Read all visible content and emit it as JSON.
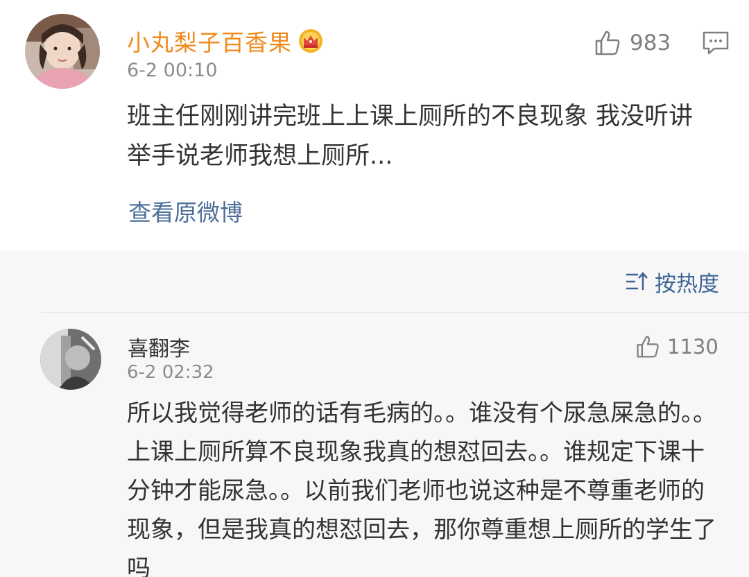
{
  "post": {
    "username": "小丸梨子百香果",
    "badge_icon": "crown-icon",
    "time": "6-2 00:10",
    "like_count": "983",
    "like_icon": "thumbs-up-icon",
    "comment_icon": "comment-icon",
    "text": "班主任刚刚讲完班上上课上厕所的不良现象 我没听讲 举手说老师我想上厕所...",
    "view_original": "查看原微博"
  },
  "sort": {
    "icon": "sort-icon",
    "label": "按热度"
  },
  "comment": {
    "username": "喜翻李",
    "time": "6-2 02:32",
    "like_count": "1130",
    "like_icon": "thumbs-up-icon",
    "text": "所以我觉得老师的话有毛病的。。谁没有个尿急屎急的。。上课上厕所算不良现象我真的想怼回去。。谁规定下课十分钟才能尿急。。以前我们老师也说这种是不尊重老师的现象，但是我真的想怼回去，那你尊重想上厕所的学生了吗"
  },
  "colors": {
    "username_orange": "#f08a1c",
    "link_blue": "#4d6e9a",
    "sort_blue": "#3e6494",
    "text_dark": "#333333",
    "text_gray": "#8c8c8c",
    "background": "#f7f7f7"
  }
}
